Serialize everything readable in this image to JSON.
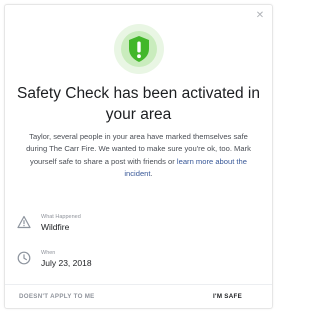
{
  "dialog": {
    "close_icon": "close-icon",
    "hero_icon": "safety-check-icon",
    "title": "Safety Check has been activated in your area",
    "message": {
      "text": "Taylor, several people in your area have marked themselves safe during The Carr Fire. We wanted to make sure you're ok, too. Mark yourself safe to share a post with friends or ",
      "link": "learn more about the incident",
      "end": "."
    },
    "what": {
      "icon": "warning-icon",
      "label": "What Happened",
      "value": "Wildfire"
    },
    "when": {
      "icon": "clock-icon",
      "label": "When",
      "value": "July 23, 2018"
    },
    "footer": {
      "secondary_label": "DOESN'T APPLY TO ME",
      "primary_label": "I'M SAFE"
    },
    "colors": {
      "accent_green": "#42b72a",
      "link_blue": "#385898",
      "text_dark": "#1c1e21",
      "text_muted": "#90949c"
    }
  }
}
